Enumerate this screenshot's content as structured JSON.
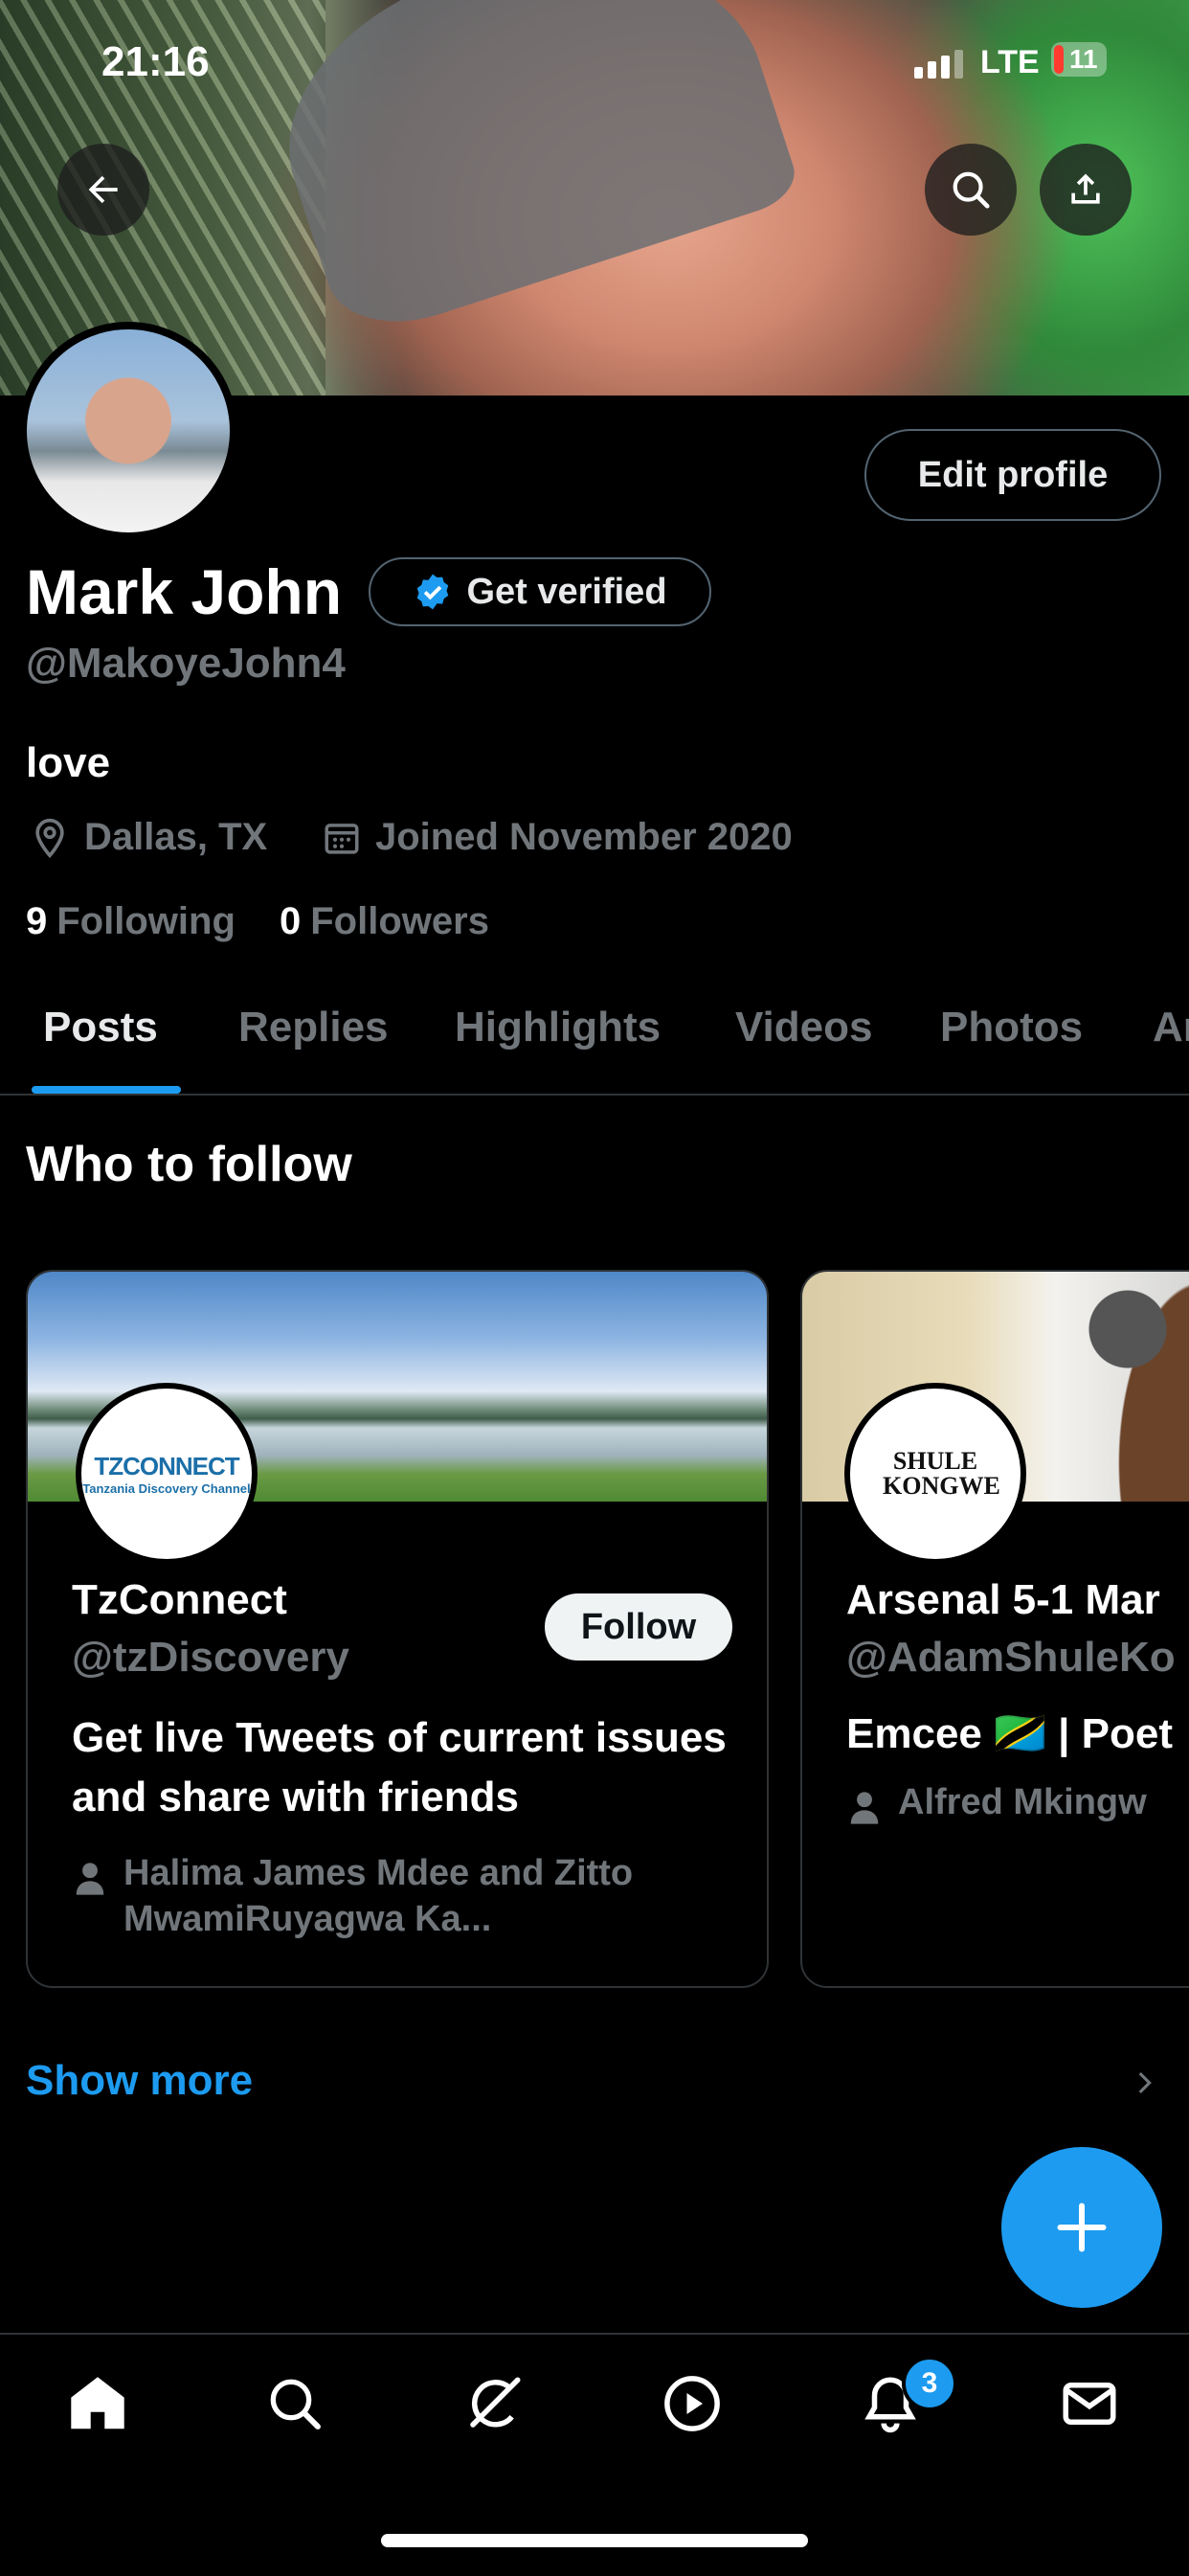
{
  "status_bar": {
    "time": "21:16",
    "network": "LTE",
    "battery": "11"
  },
  "profile": {
    "name": "Mark John",
    "handle": "@MakoyeJohn4",
    "bio": "love",
    "location": "Dallas, TX",
    "joined": "Joined November 2020",
    "following_count": "9",
    "following_label": "Following",
    "followers_count": "0",
    "followers_label": "Followers",
    "edit_profile_label": "Edit profile",
    "get_verified_label": "Get verified"
  },
  "tabs": [
    {
      "label": "Posts",
      "active": true
    },
    {
      "label": "Replies",
      "active": false
    },
    {
      "label": "Highlights",
      "active": false
    },
    {
      "label": "Videos",
      "active": false
    },
    {
      "label": "Photos",
      "active": false
    },
    {
      "label": "Ar",
      "active": false
    }
  ],
  "who_to_follow": {
    "title": "Who to follow",
    "cards": [
      {
        "name": "TzConnect",
        "handle": "@tzDiscovery",
        "follow_label": "Follow",
        "bio": "Get live Tweets of current issues and share with friends",
        "followed_by": "Halima James Mdee and Zitto MwamiRuyagwa Ka...",
        "logo_text": "TZCONNECT",
        "logo_subtext": "Tanzania Discovery Channel"
      },
      {
        "name": "Arsenal 5-1 Mar",
        "handle": "@AdamShuleKo",
        "bio": "Emcee 🇹🇿 | Poet",
        "followed_by": "Alfred Mkingw",
        "logo_text": "SHULE KONGWE"
      }
    ],
    "show_more_label": "Show more"
  },
  "bottom_nav": {
    "items": [
      "home-icon",
      "search-icon",
      "grok-icon",
      "video-icon",
      "notifications-icon",
      "messages-icon"
    ],
    "notification_badge": "3"
  },
  "colors": {
    "accent": "#1d9bf0",
    "muted": "#71767b",
    "border": "#2f3336"
  }
}
